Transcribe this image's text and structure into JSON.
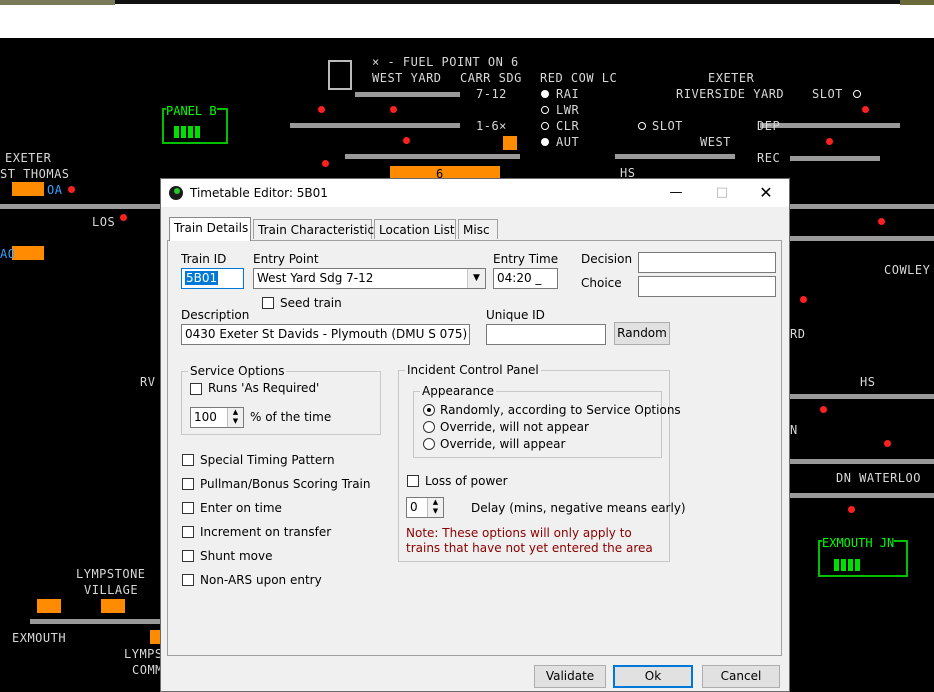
{
  "sim": {
    "labels": {
      "fuel_point": "× - FUEL POINT ON 6",
      "west_yard": "WEST YARD",
      "carr_sdg": "CARR SDG",
      "red_cow_lc": "RED COW LC",
      "dest_7_12": "7-12",
      "dest_1_6": "1-6×",
      "rai": "RAI",
      "lwr": "LWR",
      "clr": "CLR",
      "aut": "AUT",
      "slot_mid": "SLOT",
      "exeter_right": "EXETER",
      "riverside_yard": "RIVERSIDE YARD",
      "slot_right": "SLOT",
      "west": "WEST",
      "dep": "DEP",
      "rec": "REC",
      "panel_b": "PANEL B",
      "exeter_left": "EXETER",
      "st_thomas": "ST THOMAS",
      "los": "LOS",
      "hs_top": "HS",
      "six": "6",
      "cowley": "COWLEY",
      "rd": "RD",
      "rv": "RV",
      "hs_right": "HS",
      "n": "N",
      "dn_waterloo": "DN WATERLOO",
      "exmouth_jn": "EXMOUTH JN",
      "lympstone": "LYMPSTONE",
      "village": "VILLAGE",
      "exmouth": "EXMOUTH",
      "lymps": "LYMPS",
      "comm": "COMM",
      "oa": "OA",
      "ao": "AO"
    }
  },
  "dialog": {
    "title": "Timetable Editor: 5B01",
    "tabs": [
      "Train Details",
      "Train Characteristics",
      "Location List",
      "Misc"
    ],
    "train_id_label": "Train ID",
    "train_id_value": "5B01",
    "entry_point_label": "Entry Point",
    "entry_point_value": "West Yard Sdg 7-12",
    "entry_time_label": "Entry Time",
    "entry_time_value": "04:20 _",
    "decision_label": "Decision",
    "choice_label": "Choice",
    "seed_train_label": "Seed train",
    "description_label": "Description",
    "description_value": "0430 Exeter St Davids - Plymouth (DMU S 075)",
    "unique_id_label": "Unique ID",
    "unique_id_value": "",
    "random_button": "Random",
    "service_options_title": "Service Options",
    "runs_as_required_label": "Runs 'As Required'",
    "percent_value": "100",
    "percent_label": "% of the time",
    "checkboxes": [
      "Special Timing Pattern",
      "Pullman/Bonus Scoring Train",
      "Enter on time",
      "Increment on transfer",
      "Shunt move",
      "Non-ARS upon entry"
    ],
    "incident_title": "Incident Control Panel",
    "appearance_title": "Appearance",
    "appearance_options": [
      "Randomly, according to Service Options",
      "Override, will not appear",
      "Override, will appear"
    ],
    "appearance_selected": 0,
    "loss_of_power_label": "Loss of power",
    "delay_value": "0",
    "delay_label": "Delay (mins, negative means early)",
    "note": "Note: These options will only apply to trains that have not yet entered the area",
    "validate_button": "Validate",
    "ok_button": "Ok",
    "cancel_button": "Cancel"
  },
  "colors": {
    "signal_red": "#ff2020",
    "occupied_orange": "#ff8c00",
    "panel_green": "#00c000",
    "focus_blue": "#0078d7",
    "note_red": "#8b0000"
  }
}
